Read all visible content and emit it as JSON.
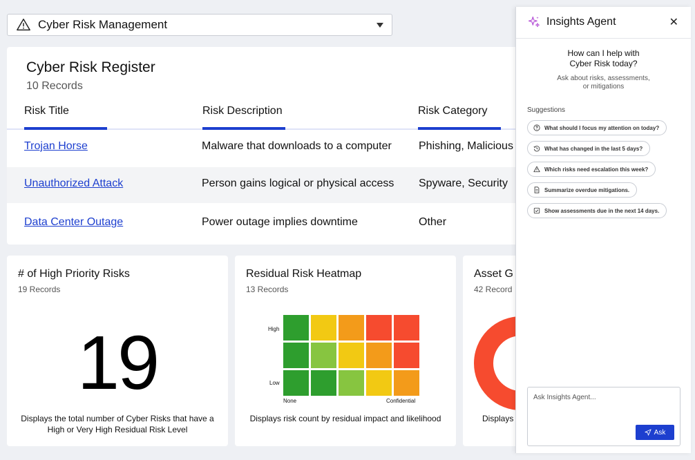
{
  "selector": {
    "label": "Cyber Risk Management"
  },
  "register": {
    "title": "Cyber Risk Register",
    "count": "10 Records",
    "columns": [
      "Risk Title",
      "Risk Description",
      "Risk Category"
    ],
    "rows": [
      [
        "Trojan Horse",
        "Malware that downloads to a computer",
        "Phishing, Malicious"
      ],
      [
        "Unauthorized Attack",
        "Person gains logical or physical access",
        "Spyware, Security"
      ],
      [
        "Data Center Outage",
        "Power outage implies downtime",
        "Other"
      ]
    ]
  },
  "cards": {
    "high_priority": {
      "title": "# of High Priority Risks",
      "count": "19 Records",
      "value": "19",
      "description": "Displays the total number of Cyber Risks that have a High or Very High Residual Risk Level"
    },
    "heatmap": {
      "title": "Residual Risk Heatmap",
      "count": "13 Records",
      "y_high": "High",
      "y_low": "Low",
      "x_left": "None",
      "x_right": "Confidential",
      "description": "Displays risk count by residual impact and likelihood",
      "colors": {
        "green": "#2e9e2e",
        "lightgreen": "#87c540",
        "yellow": "#f2c913",
        "orange": "#f39b1a",
        "red": "#f64b2f"
      },
      "grid": [
        [
          "green",
          "yellow",
          "orange",
          "red",
          "red"
        ],
        [
          "green",
          "lightgreen",
          "yellow",
          "orange",
          "red"
        ],
        [
          "green",
          "green",
          "lightgreen",
          "yellow",
          "orange"
        ]
      ]
    },
    "asset": {
      "title": "Asset G",
      "count": "42 Record",
      "description": "Displays",
      "colors": {
        "red": "#f64b2f",
        "green": "#87c540"
      }
    }
  },
  "agent": {
    "title": "Insights Agent",
    "close_label": "✕",
    "greeting_line1": "How can I help with",
    "greeting_line2": "Cyber Risk today?",
    "sub_line1": "Ask about risks, assessments,",
    "sub_line2": "or mitigations",
    "suggestions_heading": "Suggestions",
    "suggestions": [
      {
        "icon": "question-icon",
        "label": "What should I focus my attention on today?"
      },
      {
        "icon": "history-icon",
        "label": "What has changed in the last 5 days?"
      },
      {
        "icon": "warning-icon",
        "label": "Which risks need escalation this week?"
      },
      {
        "icon": "document-icon",
        "label": "Summarize overdue mitigations."
      },
      {
        "icon": "checkbox-icon",
        "label": "Show assessments due in the next 14 days."
      }
    ],
    "input_placeholder": "Ask Insights Agent...",
    "ask_label": "Ask",
    "accent": "#1d3fcf",
    "sparkle_color": "#b44fd6"
  }
}
